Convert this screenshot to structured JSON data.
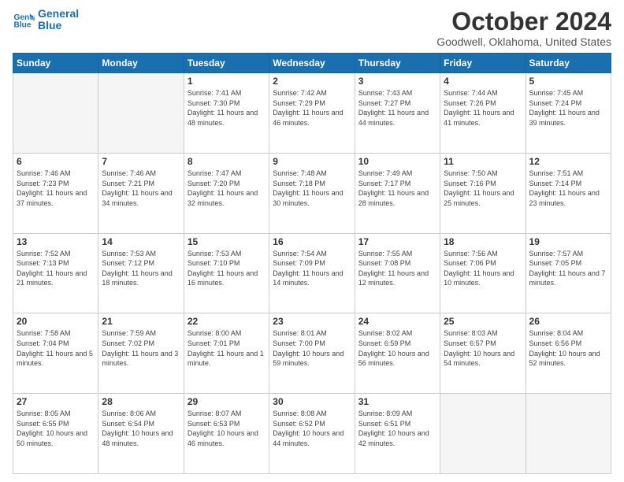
{
  "header": {
    "logo_line1": "General",
    "logo_line2": "Blue",
    "title": "October 2024",
    "subtitle": "Goodwell, Oklahoma, United States"
  },
  "days": [
    "Sunday",
    "Monday",
    "Tuesday",
    "Wednesday",
    "Thursday",
    "Friday",
    "Saturday"
  ],
  "weeks": [
    [
      {
        "day": "",
        "info": ""
      },
      {
        "day": "",
        "info": ""
      },
      {
        "day": "1",
        "info": "Sunrise: 7:41 AM\nSunset: 7:30 PM\nDaylight: 11 hours and 48 minutes."
      },
      {
        "day": "2",
        "info": "Sunrise: 7:42 AM\nSunset: 7:29 PM\nDaylight: 11 hours and 46 minutes."
      },
      {
        "day": "3",
        "info": "Sunrise: 7:43 AM\nSunset: 7:27 PM\nDaylight: 11 hours and 44 minutes."
      },
      {
        "day": "4",
        "info": "Sunrise: 7:44 AM\nSunset: 7:26 PM\nDaylight: 11 hours and 41 minutes."
      },
      {
        "day": "5",
        "info": "Sunrise: 7:45 AM\nSunset: 7:24 PM\nDaylight: 11 hours and 39 minutes."
      }
    ],
    [
      {
        "day": "6",
        "info": "Sunrise: 7:46 AM\nSunset: 7:23 PM\nDaylight: 11 hours and 37 minutes."
      },
      {
        "day": "7",
        "info": "Sunrise: 7:46 AM\nSunset: 7:21 PM\nDaylight: 11 hours and 34 minutes."
      },
      {
        "day": "8",
        "info": "Sunrise: 7:47 AM\nSunset: 7:20 PM\nDaylight: 11 hours and 32 minutes."
      },
      {
        "day": "9",
        "info": "Sunrise: 7:48 AM\nSunset: 7:18 PM\nDaylight: 11 hours and 30 minutes."
      },
      {
        "day": "10",
        "info": "Sunrise: 7:49 AM\nSunset: 7:17 PM\nDaylight: 11 hours and 28 minutes."
      },
      {
        "day": "11",
        "info": "Sunrise: 7:50 AM\nSunset: 7:16 PM\nDaylight: 11 hours and 25 minutes."
      },
      {
        "day": "12",
        "info": "Sunrise: 7:51 AM\nSunset: 7:14 PM\nDaylight: 11 hours and 23 minutes."
      }
    ],
    [
      {
        "day": "13",
        "info": "Sunrise: 7:52 AM\nSunset: 7:13 PM\nDaylight: 11 hours and 21 minutes."
      },
      {
        "day": "14",
        "info": "Sunrise: 7:53 AM\nSunset: 7:12 PM\nDaylight: 11 hours and 18 minutes."
      },
      {
        "day": "15",
        "info": "Sunrise: 7:53 AM\nSunset: 7:10 PM\nDaylight: 11 hours and 16 minutes."
      },
      {
        "day": "16",
        "info": "Sunrise: 7:54 AM\nSunset: 7:09 PM\nDaylight: 11 hours and 14 minutes."
      },
      {
        "day": "17",
        "info": "Sunrise: 7:55 AM\nSunset: 7:08 PM\nDaylight: 11 hours and 12 minutes."
      },
      {
        "day": "18",
        "info": "Sunrise: 7:56 AM\nSunset: 7:06 PM\nDaylight: 11 hours and 10 minutes."
      },
      {
        "day": "19",
        "info": "Sunrise: 7:57 AM\nSunset: 7:05 PM\nDaylight: 11 hours and 7 minutes."
      }
    ],
    [
      {
        "day": "20",
        "info": "Sunrise: 7:58 AM\nSunset: 7:04 PM\nDaylight: 11 hours and 5 minutes."
      },
      {
        "day": "21",
        "info": "Sunrise: 7:59 AM\nSunset: 7:02 PM\nDaylight: 11 hours and 3 minutes."
      },
      {
        "day": "22",
        "info": "Sunrise: 8:00 AM\nSunset: 7:01 PM\nDaylight: 11 hours and 1 minute."
      },
      {
        "day": "23",
        "info": "Sunrise: 8:01 AM\nSunset: 7:00 PM\nDaylight: 10 hours and 59 minutes."
      },
      {
        "day": "24",
        "info": "Sunrise: 8:02 AM\nSunset: 6:59 PM\nDaylight: 10 hours and 56 minutes."
      },
      {
        "day": "25",
        "info": "Sunrise: 8:03 AM\nSunset: 6:57 PM\nDaylight: 10 hours and 54 minutes."
      },
      {
        "day": "26",
        "info": "Sunrise: 8:04 AM\nSunset: 6:56 PM\nDaylight: 10 hours and 52 minutes."
      }
    ],
    [
      {
        "day": "27",
        "info": "Sunrise: 8:05 AM\nSunset: 6:55 PM\nDaylight: 10 hours and 50 minutes."
      },
      {
        "day": "28",
        "info": "Sunrise: 8:06 AM\nSunset: 6:54 PM\nDaylight: 10 hours and 48 minutes."
      },
      {
        "day": "29",
        "info": "Sunrise: 8:07 AM\nSunset: 6:53 PM\nDaylight: 10 hours and 46 minutes."
      },
      {
        "day": "30",
        "info": "Sunrise: 8:08 AM\nSunset: 6:52 PM\nDaylight: 10 hours and 44 minutes."
      },
      {
        "day": "31",
        "info": "Sunrise: 8:09 AM\nSunset: 6:51 PM\nDaylight: 10 hours and 42 minutes."
      },
      {
        "day": "",
        "info": ""
      },
      {
        "day": "",
        "info": ""
      }
    ]
  ]
}
